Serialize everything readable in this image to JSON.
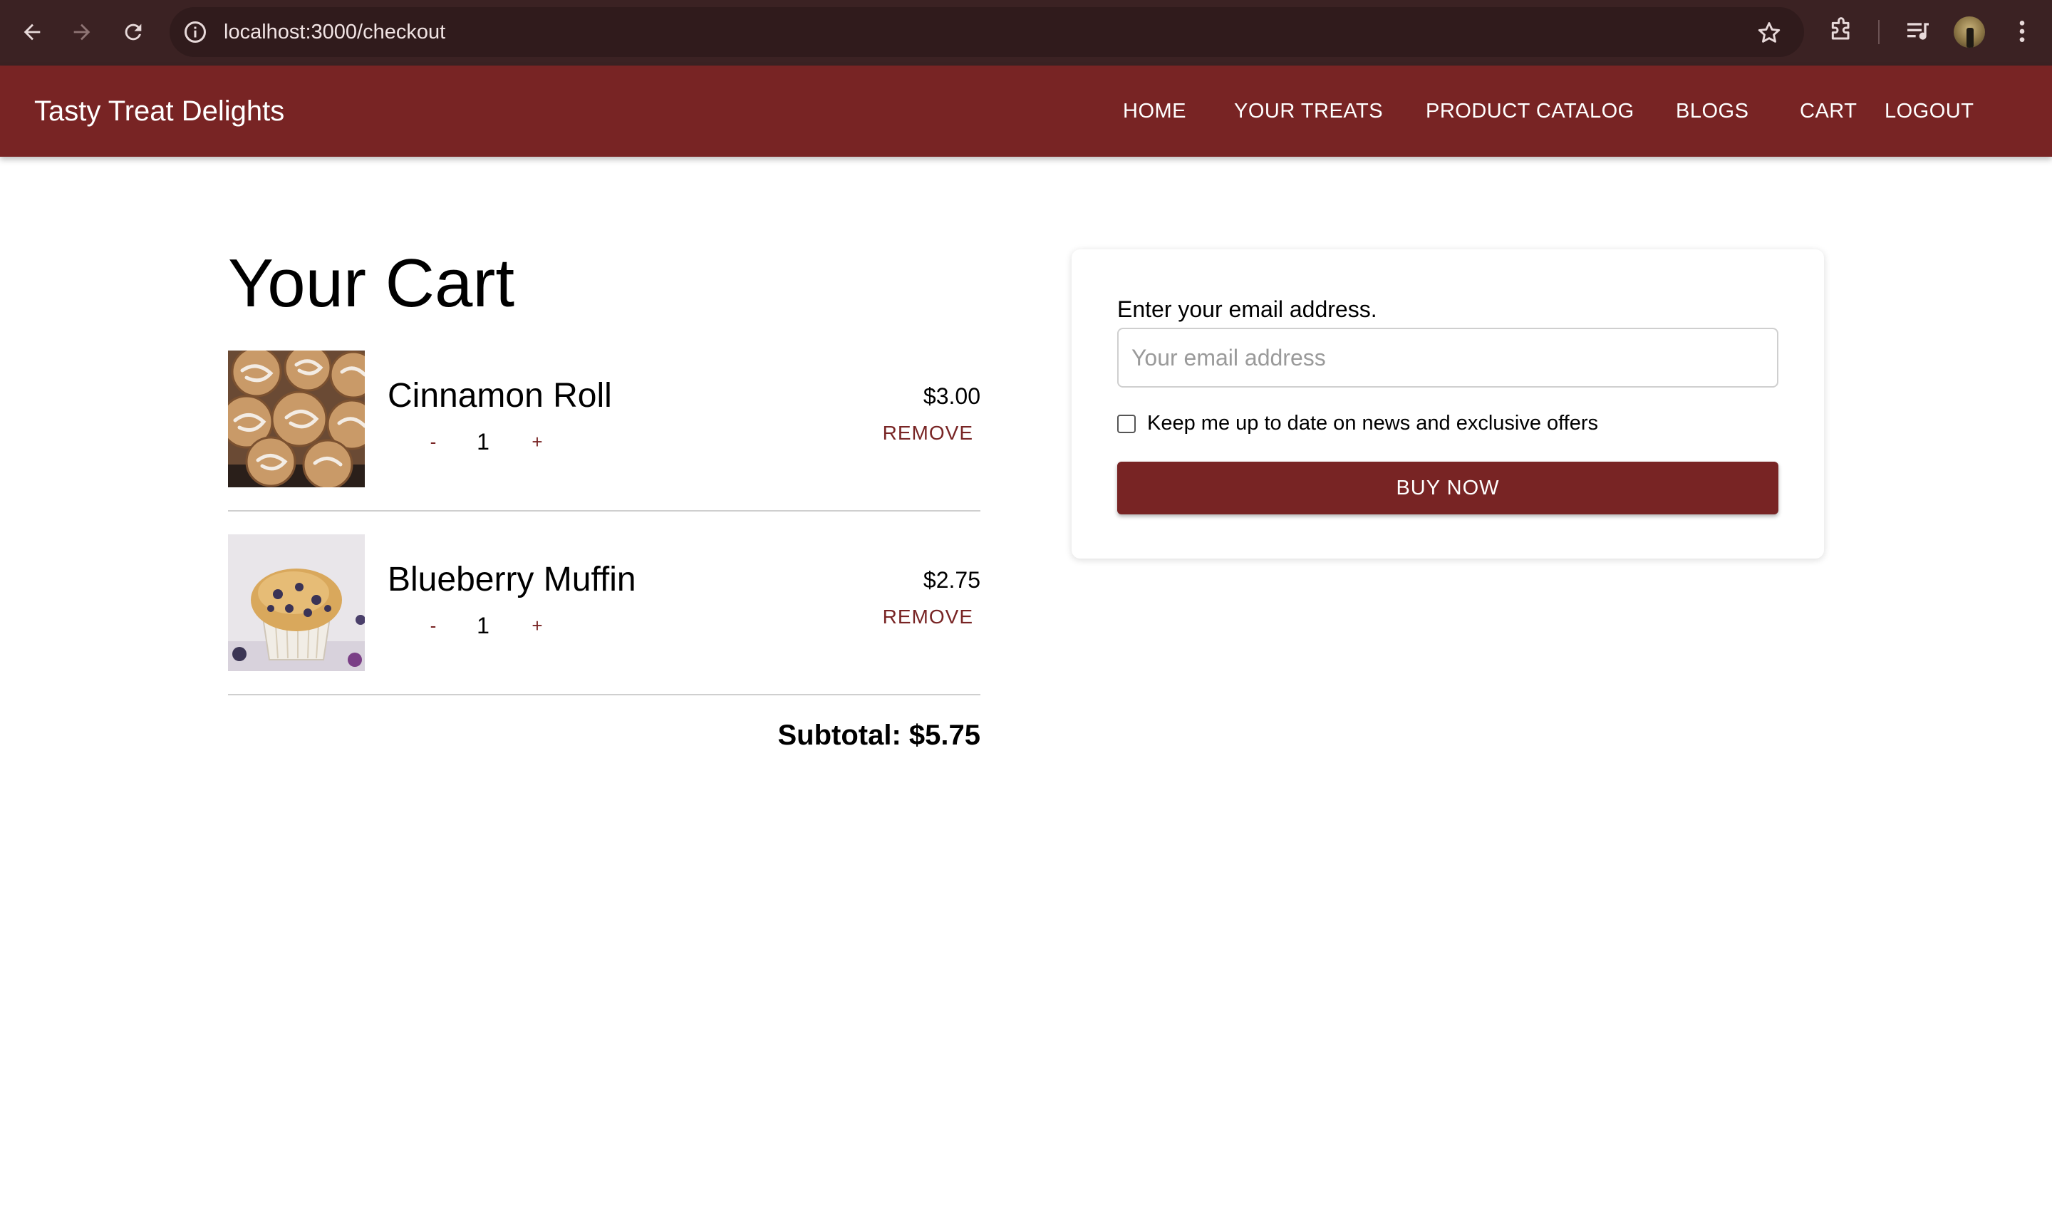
{
  "browser": {
    "url": "localhost:3000/checkout"
  },
  "app": {
    "brand": "Tasty Treat Delights",
    "nav": [
      {
        "label": "HOME"
      },
      {
        "label": "YOUR TREATS"
      },
      {
        "label": "PRODUCT CATALOG"
      },
      {
        "label": "BLOGS"
      },
      {
        "label": "CART"
      },
      {
        "label": "LOGOUT"
      }
    ],
    "accent_color": "#782424"
  },
  "cart": {
    "title": "Your Cart",
    "items": [
      {
        "name": "Cinnamon Roll",
        "price": "$3.00",
        "quantity": "1",
        "minus": "-",
        "plus": "+",
        "remove": "REMOVE",
        "image": "cinnamon-roll-photo"
      },
      {
        "name": "Blueberry Muffin",
        "price": "$2.75",
        "quantity": "1",
        "minus": "-",
        "plus": "+",
        "remove": "REMOVE",
        "image": "blueberry-muffin-photo"
      }
    ],
    "subtotal": "Subtotal: $5.75"
  },
  "checkout": {
    "email_label": "Enter your email address.",
    "email_placeholder": "Your email address",
    "email_value": "",
    "newsletter_label": "Keep me up to date on news and exclusive offers",
    "newsletter_checked": false,
    "buy_label": "BUY NOW"
  }
}
